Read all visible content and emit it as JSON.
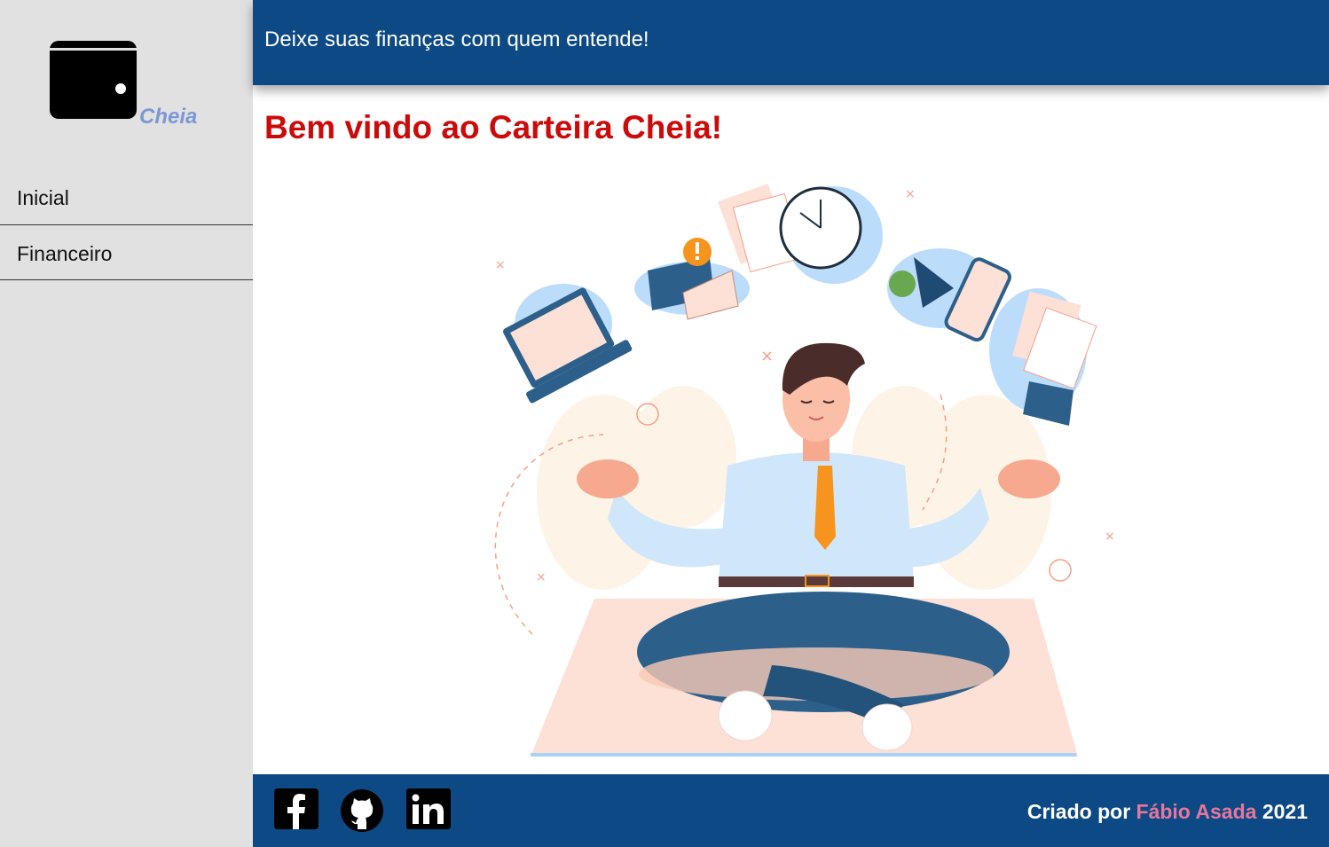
{
  "brand": {
    "logo_icon": "wallet-icon",
    "logo_text": "Cheia"
  },
  "nav": {
    "items": [
      {
        "label": "Inicial"
      },
      {
        "label": "Financeiro"
      }
    ]
  },
  "header": {
    "tagline": "Deixe suas finanças com quem entende!"
  },
  "main": {
    "welcome_title": "Bem vindo ao Carteira Cheia!",
    "illustration": "meditating-businessman-illustration"
  },
  "footer": {
    "social": [
      {
        "icon": "facebook-icon"
      },
      {
        "icon": "github-icon"
      },
      {
        "icon": "linkedin-icon"
      }
    ],
    "credit_prefix": "Criado por",
    "credit_author": "Fábio Asada",
    "credit_year": "2021"
  },
  "colors": {
    "sidebar_bg": "#e1e1e1",
    "brand_blue": "#0c4985",
    "title_red": "#cc0a0a",
    "author_pink": "#e8769a",
    "logo_text": "#7b97d4"
  }
}
